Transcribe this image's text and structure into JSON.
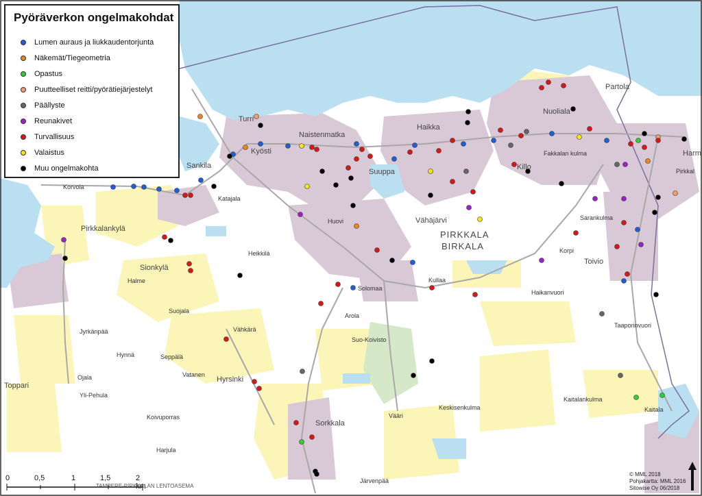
{
  "legend": {
    "title": "Pyöräverkon ongelmakohdat",
    "items": [
      {
        "label": "Lumen auraus ja liukkaudentorjunta",
        "color": "#1f5fd6"
      },
      {
        "label": "Näkemät/Tiegeometria",
        "color": "#e8891e"
      },
      {
        "label": "Opastus",
        "color": "#2ed12e"
      },
      {
        "label": "Puutteelliset reitti/pyörätiejärjestelyt",
        "color": "#f0a070"
      },
      {
        "label": "Päällyste",
        "color": "#666666"
      },
      {
        "label": "Reunakivet",
        "color": "#a020c8"
      },
      {
        "label": "Turvallisuus",
        "color": "#d81818"
      },
      {
        "label": "Valaistus",
        "color": "#f4e418"
      },
      {
        "label": "Muu ongelmakohta",
        "color": "#000000"
      }
    ]
  },
  "places": {
    "turri": "Turri",
    "kyosti": "Kyösti",
    "naistenmatka": "Naistenmatka",
    "haikka": "Haikka",
    "nuoliala": "Nuoliala",
    "partola": "Partola",
    "sankila": "Sankila",
    "suuppa": "Suuppa",
    "killo": "Killo",
    "katajala": "Katajala",
    "pirkkalankyla": "Pirkkalankylä",
    "vahajarvi": "Vähäjärvi",
    "pirkkala": "PIRKKALA",
    "birkala": "BIRKALA",
    "sarankulma": "Sarankulma",
    "toivio": "Toivio",
    "sionkyla": "Sionkylä",
    "heikkila": "Heikkilä",
    "huovi": "Huovi",
    "solomaa": "Solomaa",
    "arola": "Arola",
    "suokoivisto": "Suo-Koivisto",
    "jyrkanpaa": "Jyrkänpää",
    "vahkara": "Vähkärä",
    "hyrsinki": "Hyrsinki",
    "hynna": "Hynnä",
    "seppala": "Seppälä",
    "vatanen": "Vatanen",
    "ojala": "Ojala",
    "ylipehula": "Yli-Pehula",
    "toppari": "Toppari",
    "koivuporras": "Koivuporras",
    "harjula": "Harjula",
    "sorkkala": "Sorkkala",
    "keskisenkulma": "Keskisenkulma",
    "kaitalankulma": "Kaitalankulma",
    "vaari": "Vääri",
    "jarvenpaa": "Järvenpää",
    "haikanvuori": "Haikanvuori",
    "taaporinvuori": "Taaporinvuori",
    "fakkalankulma": "Fakkalan kulma",
    "korpi": "Korpi",
    "kullaa": "Kullaa",
    "halme": "Halme",
    "korvola": "Korvola",
    "suojala": "Suojala",
    "kaitala": "Kaitala",
    "harm": "Harm",
    "pirkkal": "Pirkkal"
  },
  "scale": {
    "labels": [
      "0",
      "0,5",
      "1",
      "1,5",
      "2 km"
    ]
  },
  "airport": "TAMPERE-PIRKKALAN LENTOASEMA",
  "credits": {
    "line1": "© MML 2018",
    "line2": "Pohjakartta: MML 2016",
    "line3": "Sitowise Oy 06/2018"
  },
  "colors": {
    "water": "#b9dff0",
    "land": "#ffffff",
    "urban": "#d9c8d6",
    "field": "#fbf5b8",
    "forest_green": "#d5e8c8",
    "border": "#7a6ea0"
  }
}
